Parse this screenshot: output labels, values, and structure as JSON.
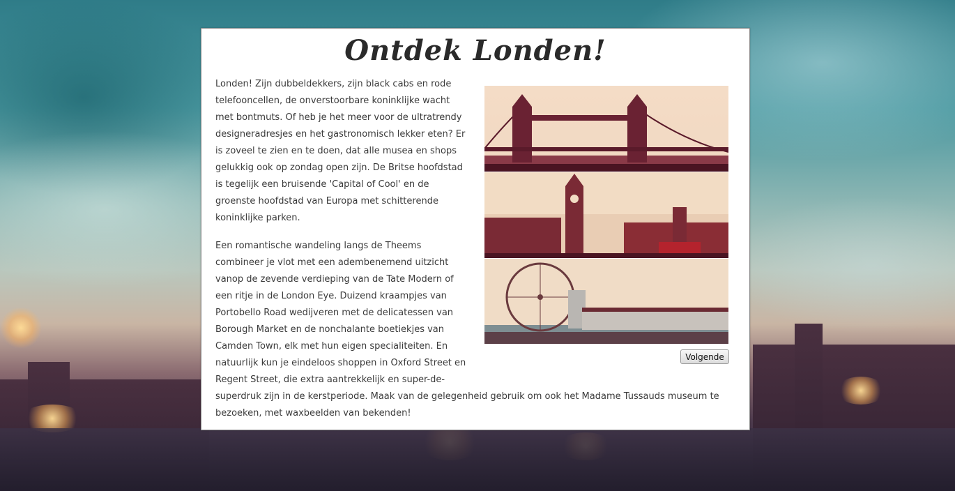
{
  "page": {
    "title": "Ontdek Londen!"
  },
  "article": {
    "paragraph1": "Londen! Zijn dubbeldekkers, zijn black cabs en rode telefooncellen, de onverstoorbare koninklijke wacht met bontmuts. Of heb je het meer voor de ultratrendy designeradresjes en het gastronomisch lekker eten? Er is zoveel te zien en te doen, dat alle musea en shops gelukkig ook op zondag open zijn. De Britse hoofdstad is tegelijk een bruisende 'Capital of Cool' en de groenste hoofdstad van Europa met schitterende koninklijke parken.",
    "paragraph2": "Een romantische wandeling langs de Theems combineer je vlot met een adembenemend uitzicht vanop de zevende verdieping van de Tate Modern of een ritje in de London Eye. Duizend kraampjes van Portobello Road wedijveren met de delicatessen van Borough Market en de nonchalante boetiekjes van Camden Town, elk met hun eigen specialiteiten. En natuurlijk kun je eindeloos shoppen in Oxford Street en Regent Street, die extra aantrekkelijk en super-de-superdruk zijn in de kerstperiode. Maak van de gelegenheid gebruik om ook het Madame Tussauds museum te bezoeken, met waxbeelden van bekenden!"
  },
  "slideshow": {
    "next_label": "Volgende"
  },
  "colors": {
    "panel_background": "#ffffff",
    "text": "#3a3a3a",
    "sky": "#2f7c88"
  }
}
